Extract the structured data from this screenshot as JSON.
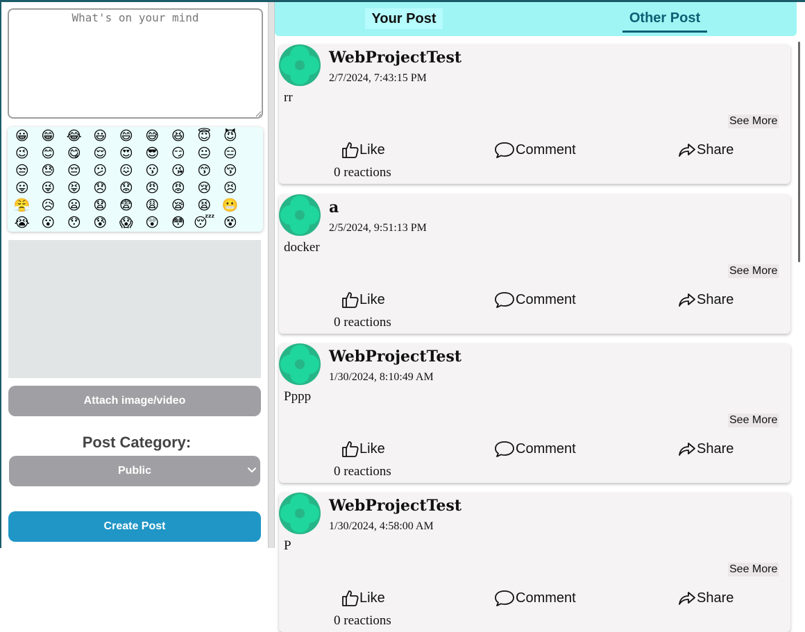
{
  "composer": {
    "placeholder": "What's on your mind",
    "emojis": [
      "😀",
      "😁",
      "😂",
      "😃",
      "😄",
      "😅",
      "😆",
      "😇",
      "😈",
      "😉",
      "😊",
      "😋",
      "😌",
      "😍",
      "😎",
      "😏",
      "😐",
      "😑",
      "😒",
      "😓",
      "😔",
      "😕",
      "😖",
      "😗",
      "😘",
      "😙",
      "😚",
      "😛",
      "😜",
      "😝",
      "😞",
      "😟",
      "😠",
      "😡",
      "😢",
      "😣",
      "😤",
      "😥",
      "😦",
      "😧",
      "😨",
      "😩",
      "😪",
      "😫",
      "😬",
      "😭",
      "😮",
      "😯",
      "😰",
      "😱",
      "😲",
      "😳",
      "😴",
      "😵"
    ],
    "attach_label": "Attach image/video",
    "category_label": "Post Category:",
    "category_value": "Public",
    "create_label": "Create Post"
  },
  "tabs": {
    "your_post": "Your Post",
    "other_post": "Other Post",
    "active": "Other Post"
  },
  "posts": [
    {
      "author": "WebProjectTest",
      "date": "2/7/2024, 7:43:15 PM",
      "content": "rr",
      "see_more": "See More",
      "like": "Like",
      "comment": "Comment",
      "share": "Share",
      "reactions": "0 reactions"
    },
    {
      "author": "a",
      "date": "2/5/2024, 9:51:13 PM",
      "content": "docker",
      "see_more": "See More",
      "like": "Like",
      "comment": "Comment",
      "share": "Share",
      "reactions": "0 reactions"
    },
    {
      "author": "WebProjectTest",
      "date": "1/30/2024, 8:10:49 AM",
      "content": "Pppp",
      "see_more": "See More",
      "like": "Like",
      "comment": "Comment",
      "share": "Share",
      "reactions": "0 reactions"
    },
    {
      "author": "WebProjectTest",
      "date": "1/30/2024, 4:58:00 AM",
      "content": "P",
      "see_more": "See More",
      "like": "Like",
      "comment": "Comment",
      "share": "Share",
      "reactions": "0 reactions"
    }
  ],
  "colors": {
    "tab_bar": "#9ff5f4",
    "active_tab": "#0e5f74",
    "create_button": "#2096c6",
    "gray_button": "#a0a0a4",
    "avatar_bg": "#27b587",
    "avatar_fg": "#1fd69d"
  },
  "icons": {
    "like": "thumbs-up-icon",
    "comment": "speech-bubble-icon",
    "share": "share-arrow-icon",
    "select": "chevron-down-icon"
  }
}
